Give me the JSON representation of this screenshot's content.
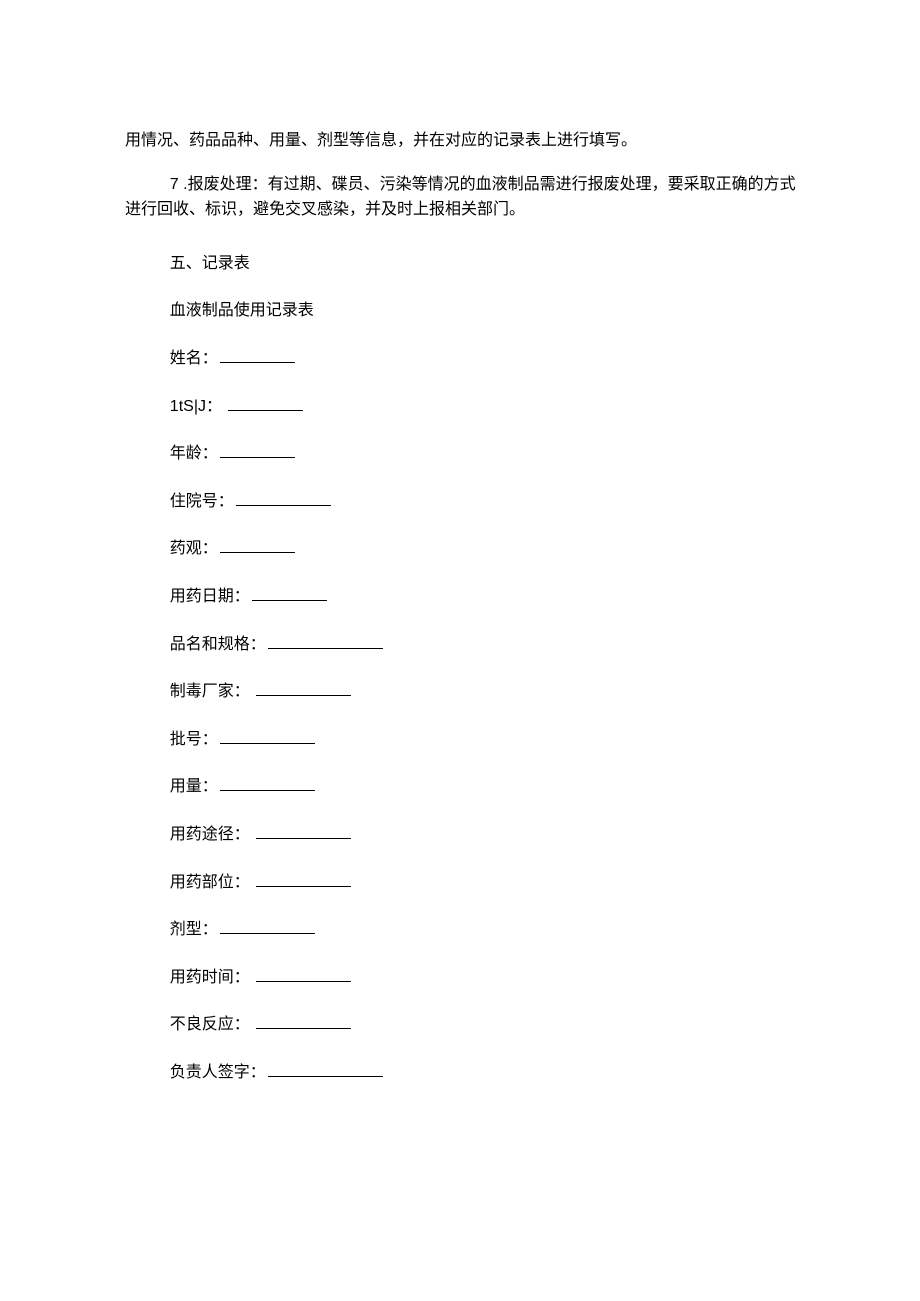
{
  "para1": "用情况、药品品种、用量、剂型等信息，并在对应的记录表上进行填写。",
  "para2_prefix": "7 .",
  "para2": "报废处理：有过期、碟员、污染等情况的血液制品需进行报废处理，要采取正确的方式进行回收、标识，避免交叉感染，并及时上报相关部门。",
  "section5": "五、记录表",
  "formTitle": "血液制品使用记录表",
  "fields": {
    "name": "姓名：",
    "tsij": "1tS|J：",
    "age": "年龄：",
    "hospitalNo": "住院号：",
    "yaoguan": "药观：",
    "medDate": "用药日期：",
    "nameSpec": "品名和规格：",
    "manufacturer": "制毒厂家：",
    "batchNo": "批号：",
    "dosage": "用量：",
    "route": "用药途径：",
    "site": "用药部位：",
    "formType": "剂型：",
    "medTime": "用药时间：",
    "adverseReaction": "不良反应：",
    "signature": "负责人签字："
  }
}
